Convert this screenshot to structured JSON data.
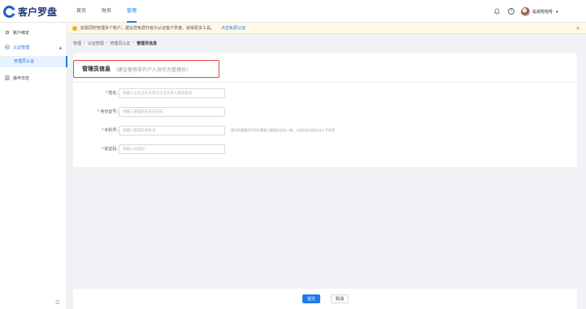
{
  "app": {
    "logo_text": "客户罗盘"
  },
  "nav": {
    "items": [
      {
        "label": "首页"
      },
      {
        "label": "财务"
      },
      {
        "label": "管理"
      }
    ]
  },
  "user": {
    "name": "是胡啦啦呀"
  },
  "sidebar": {
    "items": [
      {
        "label": "账户绑定"
      },
      {
        "label": "认证管理"
      },
      {
        "label": "操作日志"
      }
    ],
    "sub_item": {
      "label": "管理员认证"
    }
  },
  "notice": {
    "text": "如需同时管理多个账户，建议您免费升级为认证客户罗盘，获得更多工具。",
    "link": "点击免费认证"
  },
  "breadcrumb": [
    "管理",
    "认证管理",
    "管理员认证",
    "管理员信息"
  ],
  "card": {
    "title": "管理员信息",
    "subtitle": "（建议使用非开户人员作为管理员）"
  },
  "form": {
    "fields": [
      {
        "label": "姓名:",
        "placeholder": "请输入企业业务员或与企业负责人真实姓名",
        "required": true,
        "value": ""
      },
      {
        "label": "身份证号:",
        "placeholder": "请输入管理员的身份证号",
        "required": true,
        "value": ""
      },
      {
        "label": "手机号:",
        "placeholder": "请输入管理员手机号",
        "required": true,
        "value": "",
        "hint": "填写的管理员手机号需要与管理员实名一致，与身份证号同为本人手机号"
      },
      {
        "label": "验证码:",
        "placeholder": "请输入验证码",
        "required": true,
        "value": ""
      }
    ]
  },
  "actions": {
    "submit": "提交",
    "cancel": "取消"
  },
  "colors": {
    "accent": "#1f7be8",
    "danger": "#e0463c",
    "warning": "#f7a823"
  }
}
